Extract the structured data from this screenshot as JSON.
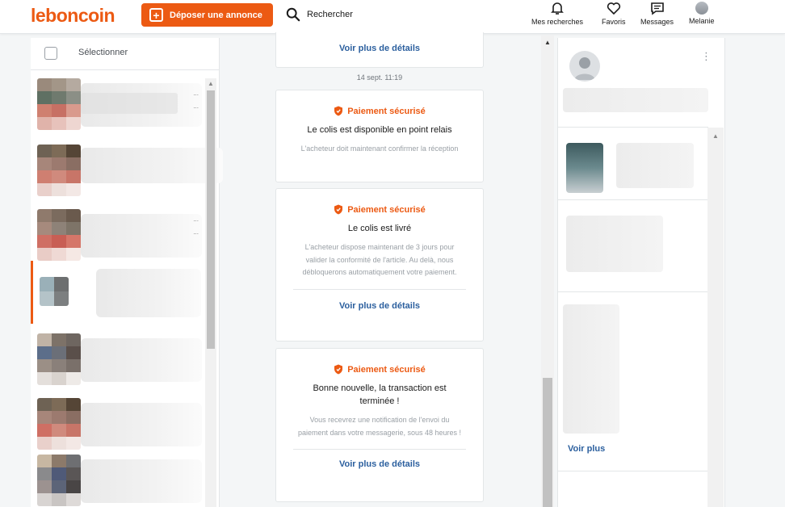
{
  "header": {
    "logo": "leboncoin",
    "post_button": "Déposer une annonce",
    "search_label": "Rechercher",
    "nav": {
      "saved_searches": "Mes recherches",
      "favorites": "Favoris",
      "messages": "Messages",
      "user": "Melanie"
    }
  },
  "conversations": {
    "select_label": "Sélectionner"
  },
  "thread": {
    "top_card": {
      "link": "Voir plus de détails"
    },
    "timestamp": "14 sept. 11:19",
    "cards": [
      {
        "badge": "Paiement sécurisé",
        "title": "Le colis est disponible en point relais",
        "description": "L'acheteur doit maintenant confirmer la réception",
        "link": ""
      },
      {
        "badge": "Paiement sécurisé",
        "title": "Le colis est livré",
        "description": "L'acheteur dispose maintenant de 3 jours pour valider la conformité de l'article. Au delà, nous débloquerons automatiquement votre paiement.",
        "link": "Voir plus de détails"
      },
      {
        "badge": "Paiement sécurisé",
        "title": "Bonne nouvelle, la transaction est terminée !",
        "description": "Vous recevrez une notification de l'envoi du paiement dans votre messagerie, sous 48 heures !",
        "link": "Voir plus de détails"
      }
    ]
  },
  "details": {
    "see_more": "Voir plus"
  },
  "colors": {
    "brand": "#ec5a13",
    "link": "#2b5f9e"
  }
}
